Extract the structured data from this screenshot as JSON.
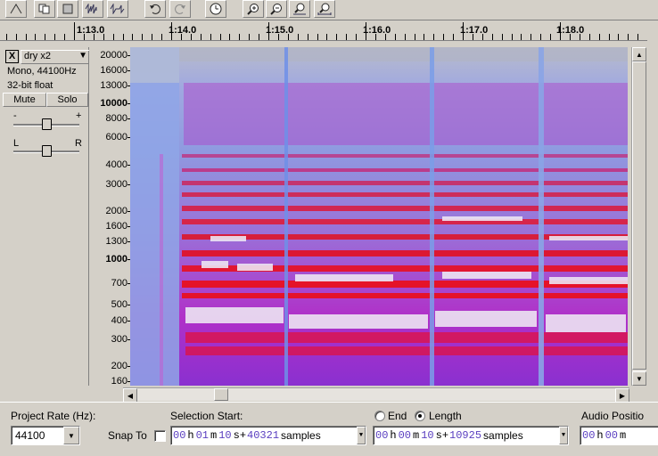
{
  "toolbar": {
    "buttons": [
      "envelope-tool-icon",
      "copy-icon",
      "paste-icon",
      "trim-icon",
      "silence-icon",
      "undo-icon",
      "redo-icon",
      "timer-icon",
      "zoom-in-icon",
      "zoom-out-icon",
      "fit-selection-icon",
      "fit-project-icon"
    ]
  },
  "ruler": {
    "ticks": [
      "1:13.0",
      "1:14.0",
      "1:15.0",
      "1:16.0",
      "1:17.0",
      "1:18.0"
    ]
  },
  "track": {
    "name": "dry x2",
    "close_label": "X",
    "menu_arrow": "▼",
    "format": "Mono, 44100Hz",
    "sample_format": "32-bit float",
    "mute_label": "Mute",
    "solo_label": "Solo",
    "gain_minus": "-",
    "gain_plus": "+",
    "pan_left": "L",
    "pan_right": "R"
  },
  "freq_axis": {
    "labels": [
      "20000",
      "16000",
      "13000",
      "10000",
      "8000",
      "6000",
      "4000",
      "3000",
      "2000",
      "1600",
      "1300",
      "1000",
      "700",
      "500",
      "400",
      "300",
      "200",
      "160"
    ]
  },
  "bottom": {
    "project_rate_label": "Project Rate (Hz):",
    "project_rate_value": "44100",
    "snap_to_label": "Snap To",
    "selection_start_label": "Selection Start:",
    "end_label": "End",
    "length_label": "Length",
    "audio_position_label": "Audio Positio",
    "start_time": {
      "h": "00",
      "m": "01",
      "s": "10",
      "samples": "40321",
      "unit": "samples"
    },
    "length_time": {
      "h": "00",
      "m": "00",
      "s": "10",
      "samples": "10925",
      "unit": "samples"
    },
    "audio_pos": {
      "h": "00",
      "m": "00"
    },
    "h_label": "h",
    "m_label": "m",
    "s_label": "s+"
  },
  "colors": {
    "spectro_low": "#8a9be0",
    "spectro_mid": "#c020c0",
    "spectro_high": "#e0102a",
    "spectro_peak": "#e8e0f0",
    "digits": "#5a3fc0"
  }
}
